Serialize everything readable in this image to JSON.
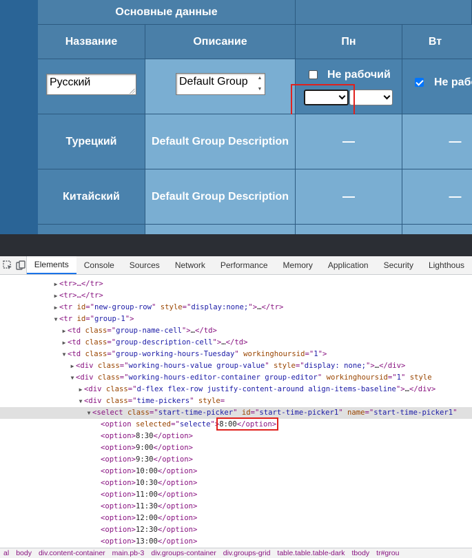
{
  "table": {
    "group_header": "Основные данные",
    "columns": [
      "Название",
      "Описание",
      "Пн",
      "Вт"
    ],
    "edit_row": {
      "name_value": "Русский",
      "description_value": "Default Group",
      "mon_not_working_label": "Не рабочий",
      "mon_not_working_checked": false,
      "tue_not_working_label": "Не рабо",
      "tue_not_working_checked": true
    },
    "rows": [
      {
        "name": "Турецкий",
        "description": "Default Group Description",
        "mon": "—",
        "tue": "—"
      },
      {
        "name": "Китайский",
        "description": "Default Group Description",
        "mon": "—",
        "tue": "—"
      }
    ]
  },
  "devtools": {
    "tabs": [
      "Elements",
      "Console",
      "Sources",
      "Network",
      "Performance",
      "Memory",
      "Application",
      "Security",
      "Lighthous"
    ],
    "active_tab": "Elements",
    "tree": [
      {
        "indent": 0,
        "tri": "▶",
        "html": "<tr>…</tr>"
      },
      {
        "indent": 0,
        "tri": "▶",
        "html": "<tr>…</tr>"
      },
      {
        "indent": 0,
        "tri": "▶",
        "parts": [
          [
            "t",
            "<tr "
          ],
          [
            "a",
            "id"
          ],
          [
            "p",
            "=\""
          ],
          [
            "v",
            "new-group-row"
          ],
          [
            "p",
            "\" "
          ],
          [
            "a",
            "style"
          ],
          [
            "p",
            "=\""
          ],
          [
            "v",
            "display:none;"
          ],
          [
            "p",
            "\">"
          ],
          [
            "x",
            "…"
          ],
          [
            "t",
            "</tr>"
          ]
        ]
      },
      {
        "indent": 0,
        "tri": "▼",
        "parts": [
          [
            "t",
            "<tr "
          ],
          [
            "a",
            "id"
          ],
          [
            "p",
            "=\""
          ],
          [
            "v",
            "group-1"
          ],
          [
            "p",
            "\">"
          ]
        ]
      },
      {
        "indent": 1,
        "tri": "▶",
        "parts": [
          [
            "t",
            "<td "
          ],
          [
            "a",
            "class"
          ],
          [
            "p",
            "=\""
          ],
          [
            "v",
            "group-name-cell"
          ],
          [
            "p",
            "\">"
          ],
          [
            "x",
            "…"
          ],
          [
            "t",
            "</td>"
          ]
        ]
      },
      {
        "indent": 1,
        "tri": "▶",
        "parts": [
          [
            "t",
            "<td "
          ],
          [
            "a",
            "class"
          ],
          [
            "p",
            "=\""
          ],
          [
            "v",
            "group-description-cell"
          ],
          [
            "p",
            "\">"
          ],
          [
            "x",
            "…"
          ],
          [
            "t",
            "</td>"
          ]
        ]
      },
      {
        "indent": 1,
        "tri": "▼",
        "parts": [
          [
            "t",
            "<td "
          ],
          [
            "a",
            "class"
          ],
          [
            "p",
            "=\""
          ],
          [
            "v",
            "group-working-hours-Tuesday"
          ],
          [
            "p",
            "\" "
          ],
          [
            "a",
            "workinghoursid"
          ],
          [
            "p",
            "=\""
          ],
          [
            "v",
            "1"
          ],
          [
            "p",
            "\">"
          ]
        ]
      },
      {
        "indent": 2,
        "tri": "▶",
        "parts": [
          [
            "t",
            "<div "
          ],
          [
            "a",
            "class"
          ],
          [
            "p",
            "=\""
          ],
          [
            "v",
            "working-hours-value group-value"
          ],
          [
            "p",
            "\" "
          ],
          [
            "a",
            "style"
          ],
          [
            "p",
            "=\""
          ],
          [
            "v",
            "display: none;"
          ],
          [
            "p",
            "\">"
          ],
          [
            "x",
            "…"
          ],
          [
            "t",
            "</div>"
          ]
        ]
      },
      {
        "indent": 2,
        "tri": "▼",
        "parts": [
          [
            "t",
            "<div "
          ],
          [
            "a",
            "class"
          ],
          [
            "p",
            "=\""
          ],
          [
            "v",
            "working-hours-editor-container group-editor"
          ],
          [
            "p",
            "\" "
          ],
          [
            "a",
            "workinghoursid"
          ],
          [
            "p",
            "=\""
          ],
          [
            "v",
            "1"
          ],
          [
            "p",
            "\" "
          ],
          [
            "a",
            "style"
          ]
        ]
      },
      {
        "indent": 3,
        "tri": "▶",
        "parts": [
          [
            "t",
            "<div "
          ],
          [
            "a",
            "class"
          ],
          [
            "p",
            "=\""
          ],
          [
            "v",
            "d-flex flex-row justify-content-around align-items-baseline"
          ],
          [
            "p",
            "\">"
          ],
          [
            "x",
            "…"
          ],
          [
            "t",
            "</div>"
          ]
        ]
      },
      {
        "indent": 3,
        "tri": "▼",
        "parts": [
          [
            "t",
            "<div "
          ],
          [
            "a",
            "class"
          ],
          [
            "p",
            "=\""
          ],
          [
            "v",
            "time-pickers"
          ],
          [
            "p",
            "\" "
          ],
          [
            "a",
            "style"
          ],
          [
            "p",
            "="
          ]
        ]
      },
      {
        "indent": 4,
        "tri": "▼",
        "hl": true,
        "parts": [
          [
            "t",
            "<select "
          ],
          [
            "a",
            "class"
          ],
          [
            "p",
            "=\""
          ],
          [
            "v",
            "start-time-picker"
          ],
          [
            "p",
            "\" "
          ],
          [
            "a",
            "id"
          ],
          [
            "p",
            "=\""
          ],
          [
            "v",
            "start-time-picker1"
          ],
          [
            "p",
            "\" "
          ],
          [
            "a",
            "name"
          ],
          [
            "p",
            "=\""
          ],
          [
            "v",
            "start-time-picker1"
          ],
          [
            "p",
            "\""
          ]
        ]
      },
      {
        "indent": 5,
        "tri": "",
        "parts": [
          [
            "t",
            "<option "
          ],
          [
            "a",
            "selected"
          ],
          [
            "p",
            "=\""
          ],
          [
            "v",
            "selecte"
          ],
          [
            "p",
            "\">"
          ],
          [
            "x",
            "8:00"
          ],
          [
            "t",
            "</option>"
          ]
        ]
      },
      {
        "indent": 5,
        "tri": "",
        "parts": [
          [
            "t",
            "<option>"
          ],
          [
            "x",
            "8:30"
          ],
          [
            "t",
            "</option>"
          ]
        ]
      },
      {
        "indent": 5,
        "tri": "",
        "parts": [
          [
            "t",
            "<option>"
          ],
          [
            "x",
            "9:00"
          ],
          [
            "t",
            "</option>"
          ]
        ]
      },
      {
        "indent": 5,
        "tri": "",
        "parts": [
          [
            "t",
            "<option>"
          ],
          [
            "x",
            "9:30"
          ],
          [
            "t",
            "</option>"
          ]
        ]
      },
      {
        "indent": 5,
        "tri": "",
        "parts": [
          [
            "t",
            "<option>"
          ],
          [
            "x",
            "10:00"
          ],
          [
            "t",
            "</option>"
          ]
        ]
      },
      {
        "indent": 5,
        "tri": "",
        "parts": [
          [
            "t",
            "<option>"
          ],
          [
            "x",
            "10:30"
          ],
          [
            "t",
            "</option>"
          ]
        ]
      },
      {
        "indent": 5,
        "tri": "",
        "parts": [
          [
            "t",
            "<option>"
          ],
          [
            "x",
            "11:00"
          ],
          [
            "t",
            "</option>"
          ]
        ]
      },
      {
        "indent": 5,
        "tri": "",
        "parts": [
          [
            "t",
            "<option>"
          ],
          [
            "x",
            "11:30"
          ],
          [
            "t",
            "</option>"
          ]
        ]
      },
      {
        "indent": 5,
        "tri": "",
        "parts": [
          [
            "t",
            "<option>"
          ],
          [
            "x",
            "12:00"
          ],
          [
            "t",
            "</option>"
          ]
        ]
      },
      {
        "indent": 5,
        "tri": "",
        "parts": [
          [
            "t",
            "<option>"
          ],
          [
            "x",
            "12:30"
          ],
          [
            "t",
            "</option>"
          ]
        ]
      },
      {
        "indent": 5,
        "tri": "",
        "parts": [
          [
            "t",
            "<option>"
          ],
          [
            "x",
            "13:00"
          ],
          [
            "t",
            "</option>"
          ]
        ]
      }
    ],
    "breadcrumb": [
      "al",
      "body",
      "div.content-container",
      "main.pb-3",
      "div.groups-container",
      "div.groups-grid",
      "table.table.table-dark",
      "tbody",
      "tr#grou"
    ]
  },
  "colors": {
    "highlight_red": "#e0201c",
    "header_blue": "#4a7fa8",
    "row_light_blue": "#7aaed2",
    "devtools_dark_bar": "#2b2e34"
  }
}
